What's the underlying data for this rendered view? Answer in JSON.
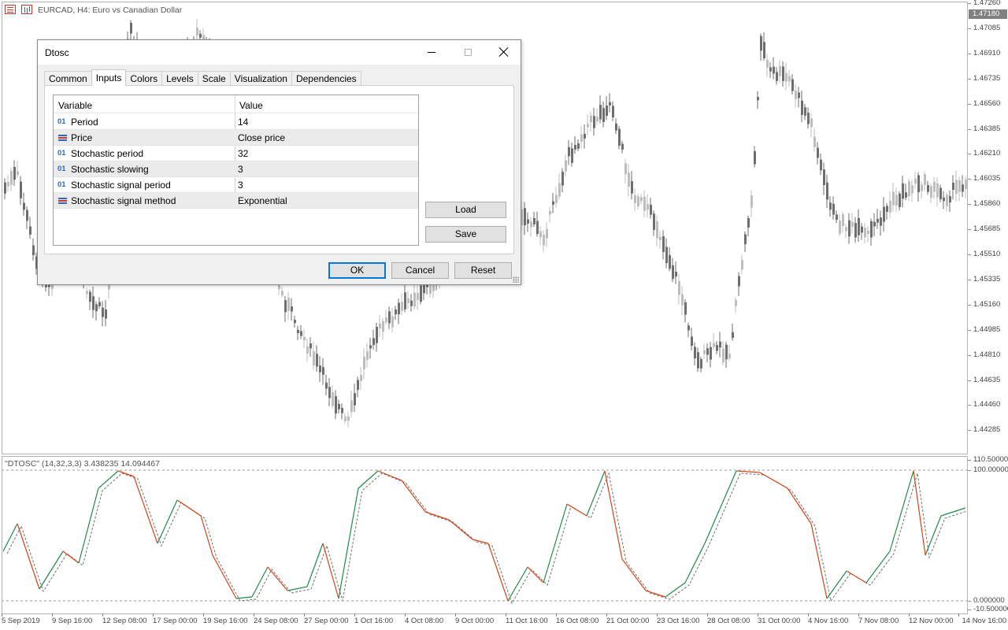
{
  "chart": {
    "title": "EURCAD, H4:  Euro vs Canadian Dollar",
    "indicator_title": "\"DTOSC\" (14,32,3,3) 3.438235 14.094467",
    "current_price": "1.47180",
    "price_labels": [
      "1.47260",
      "1.47085",
      "1.46910",
      "1.46735",
      "1.46560",
      "1.46385",
      "1.46210",
      "1.46035",
      "1.45860",
      "1.45685",
      "1.45510",
      "1.45335",
      "1.45160",
      "1.44985",
      "1.44810",
      "1.44635",
      "1.44460",
      "1.44285"
    ],
    "indicator_labels": [
      "110.500000",
      "100.000000",
      "0.000000",
      "-10.500000"
    ],
    "time_labels": [
      "5 Sep 2019",
      "9 Sep 16:00",
      "12 Sep 08:00",
      "17 Sep 00:00",
      "19 Sep 16:00",
      "24 Sep 08:00",
      "27 Sep 00:00",
      "1 Oct 16:00",
      "4 Oct 08:00",
      "9 Oct 00:00",
      "11 Oct 16:00",
      "16 Oct 08:00",
      "21 Oct 00:00",
      "23 Oct 16:00",
      "28 Oct 08:00",
      "31 Oct 00:00",
      "4 Nov 16:00",
      "7 Nov 08:00",
      "12 Nov 00:00",
      "14 Nov 16:00"
    ],
    "colors": {
      "bull_candle": "#bdbdbd",
      "bear_candle": "#6e6e6e",
      "rising_line": "#1e8a4c",
      "falling_line": "#d84315",
      "signal_line": "#707070",
      "level_line": "#9a9a9a"
    }
  },
  "dialog": {
    "title": "Dtosc",
    "tabs": [
      {
        "label": "Common"
      },
      {
        "label": "Inputs"
      },
      {
        "label": "Colors"
      },
      {
        "label": "Levels"
      },
      {
        "label": "Scale"
      },
      {
        "label": "Visualization"
      },
      {
        "label": "Dependencies"
      }
    ],
    "active_tab": "Inputs",
    "columns": {
      "variable": "Variable",
      "value": "Value"
    },
    "rows": [
      {
        "icon": "int",
        "icon_text": "01",
        "name": "Period",
        "value": "14"
      },
      {
        "icon": "enum",
        "icon_text": "",
        "name": "Price",
        "value": "Close price"
      },
      {
        "icon": "int",
        "icon_text": "01",
        "name": "Stochastic period",
        "value": "32"
      },
      {
        "icon": "int",
        "icon_text": "01",
        "name": "Stochastic slowing",
        "value": "3"
      },
      {
        "icon": "int",
        "icon_text": "01",
        "name": "Stochastic signal period",
        "value": "3"
      },
      {
        "icon": "enum",
        "icon_text": "",
        "name": "Stochastic signal method",
        "value": "Exponential"
      }
    ],
    "buttons": {
      "load": "Load",
      "save": "Save",
      "ok": "OK",
      "cancel": "Cancel",
      "reset": "Reset"
    }
  }
}
